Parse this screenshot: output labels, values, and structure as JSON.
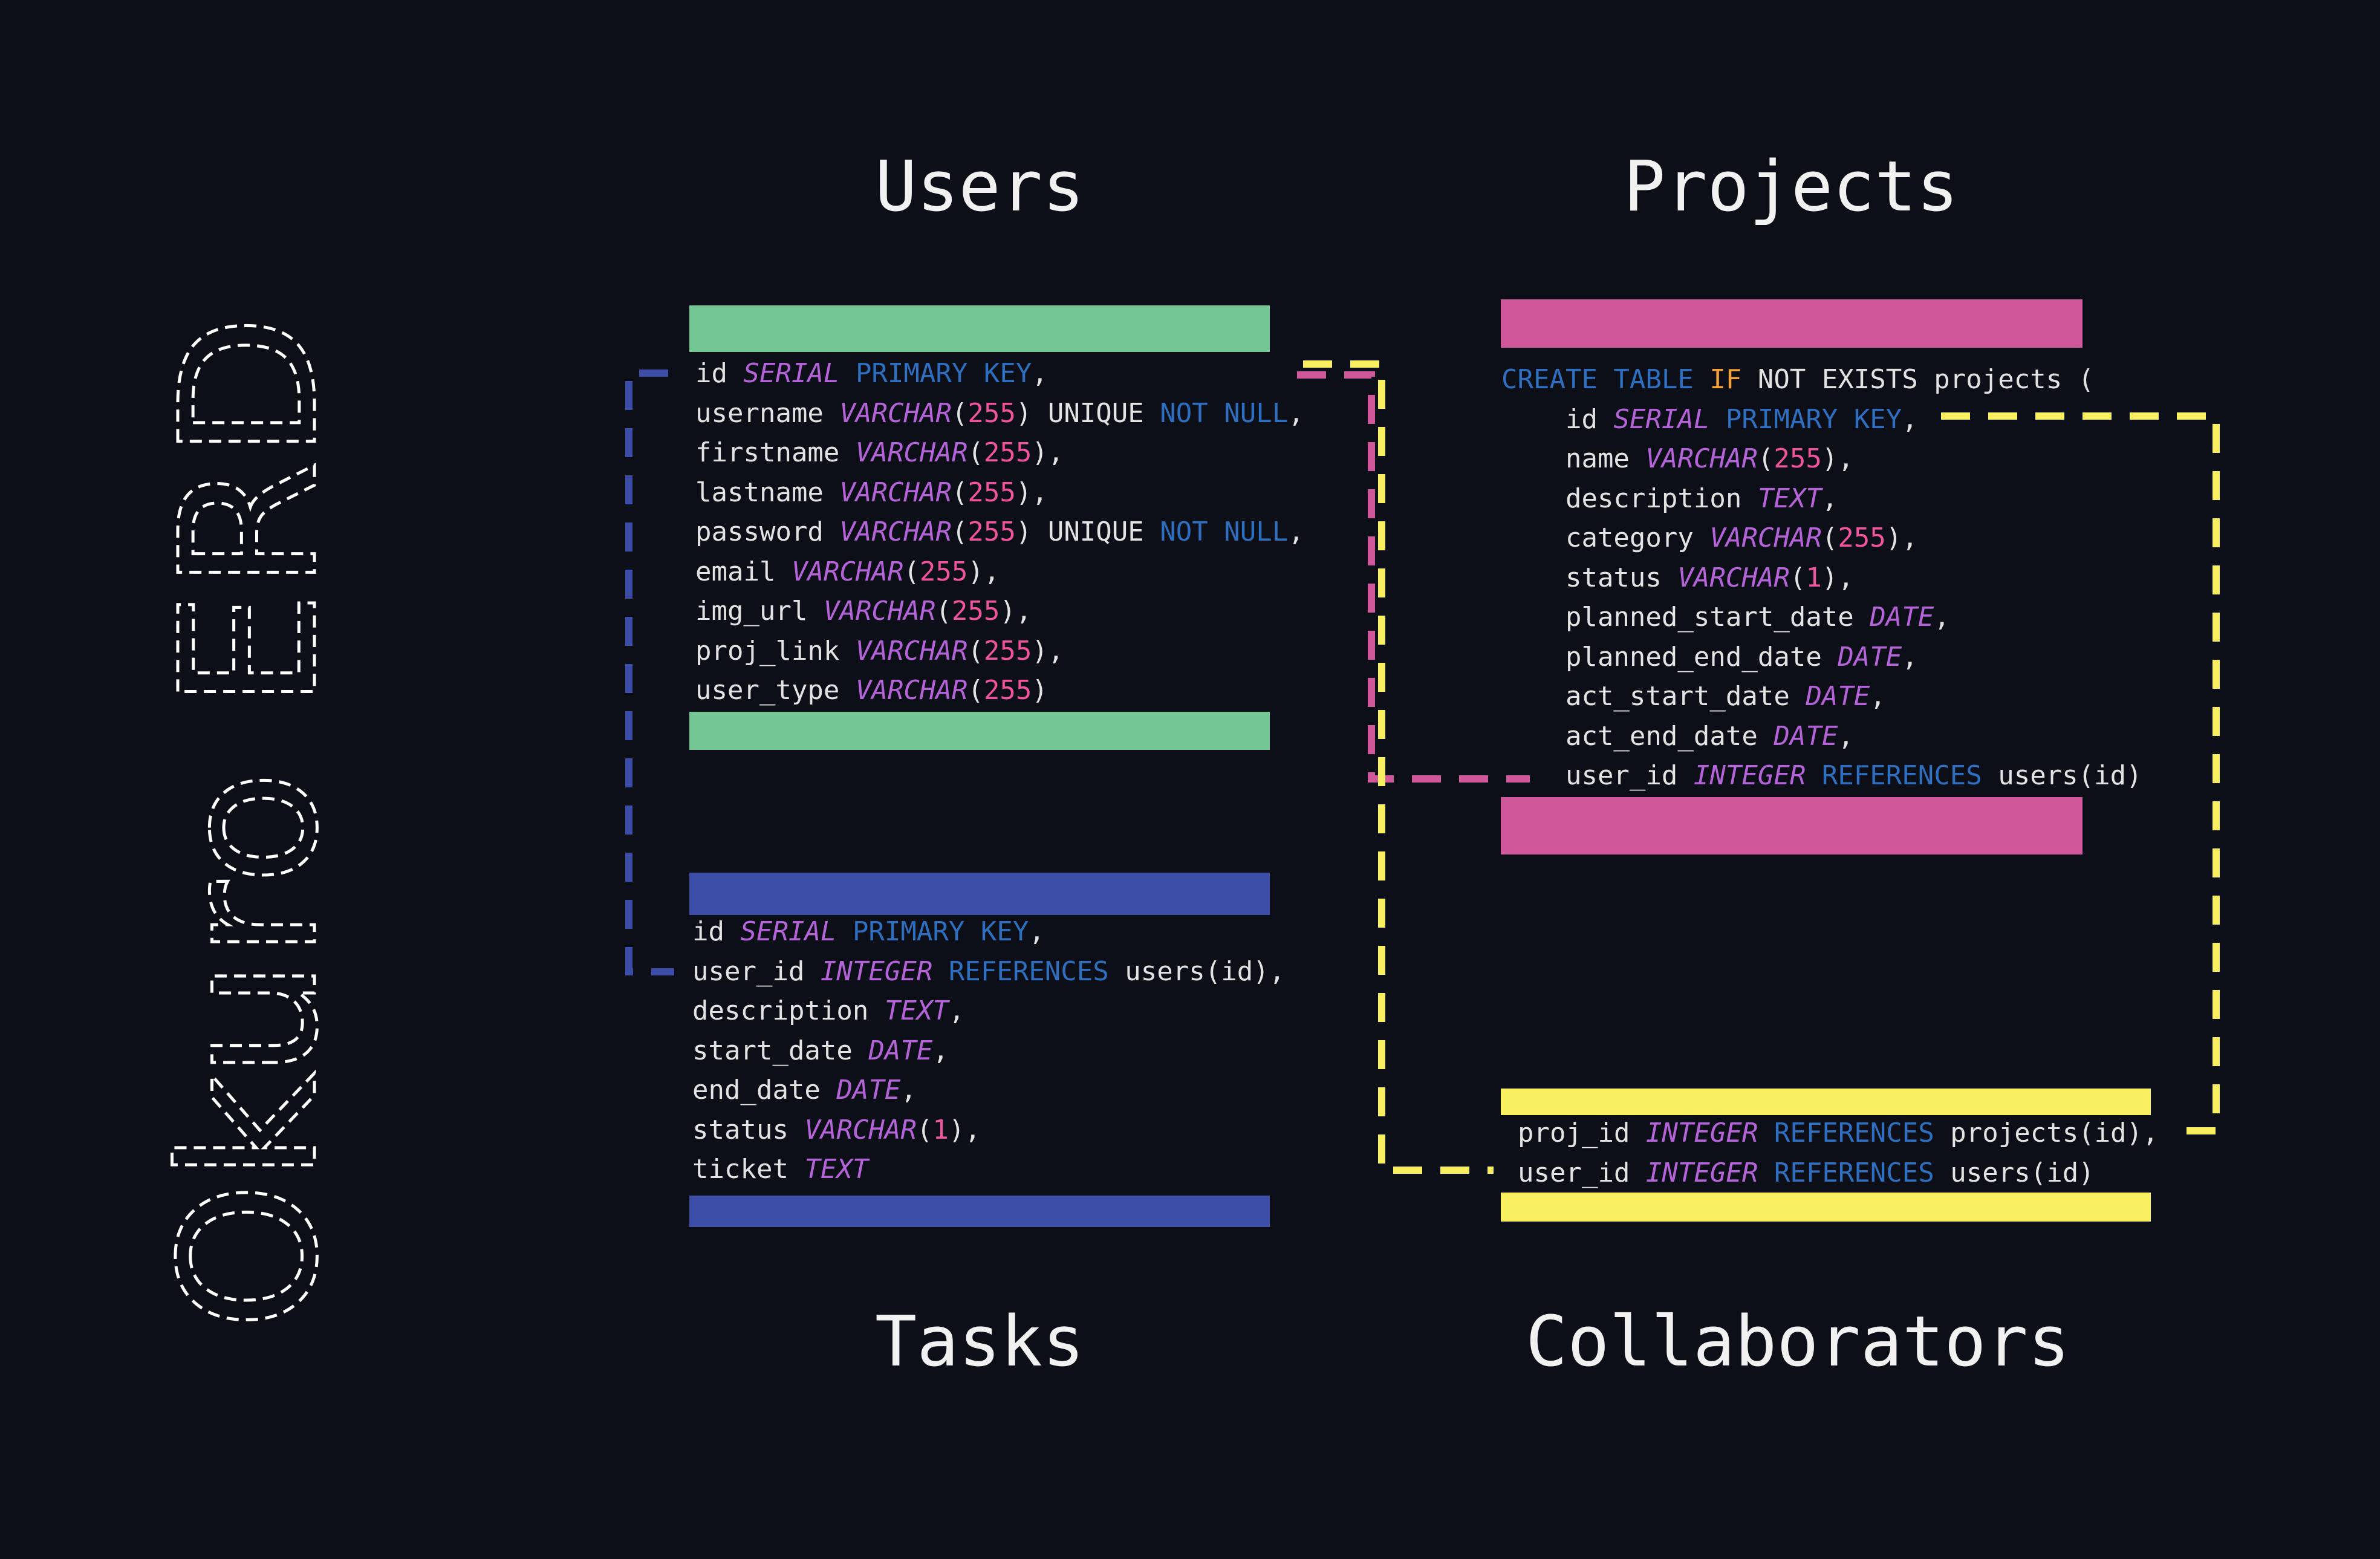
{
  "title": "Okuro ERD",
  "colors": {
    "background": "#0c0f17",
    "users": "#73c795",
    "projects": "#d0579a",
    "tasks": "#3d4ea8",
    "collaborators": "#f7ef60",
    "type": "#b563d8",
    "keyword": "#2f6fc0",
    "number": "#f0549d",
    "if_keyword": "#f2a33c",
    "text": "#e3e3e3"
  },
  "tables": {
    "users": {
      "heading": "Users",
      "lines": [
        [
          {
            "t": "id "
          },
          {
            "t": "SERIAL",
            "c": "type"
          },
          {
            "t": " "
          },
          {
            "t": "PRIMARY KEY",
            "c": "kw"
          },
          {
            "t": ","
          }
        ],
        [
          {
            "t": "username "
          },
          {
            "t": "VARCHAR",
            "c": "type"
          },
          {
            "t": "("
          },
          {
            "t": "255",
            "c": "num"
          },
          {
            "t": ") UNIQUE "
          },
          {
            "t": "NOT NULL",
            "c": "kw"
          },
          {
            "t": ","
          }
        ],
        [
          {
            "t": "firstname "
          },
          {
            "t": "VARCHAR",
            "c": "type"
          },
          {
            "t": "("
          },
          {
            "t": "255",
            "c": "num"
          },
          {
            "t": "),"
          }
        ],
        [
          {
            "t": "lastname "
          },
          {
            "t": "VARCHAR",
            "c": "type"
          },
          {
            "t": "("
          },
          {
            "t": "255",
            "c": "num"
          },
          {
            "t": "),"
          }
        ],
        [
          {
            "t": "password "
          },
          {
            "t": "VARCHAR",
            "c": "type"
          },
          {
            "t": "("
          },
          {
            "t": "255",
            "c": "num"
          },
          {
            "t": ") UNIQUE "
          },
          {
            "t": "NOT NULL",
            "c": "kw"
          },
          {
            "t": ","
          }
        ],
        [
          {
            "t": "email "
          },
          {
            "t": "VARCHAR",
            "c": "type"
          },
          {
            "t": "("
          },
          {
            "t": "255",
            "c": "num"
          },
          {
            "t": "),"
          }
        ],
        [
          {
            "t": "img_url "
          },
          {
            "t": "VARCHAR",
            "c": "type"
          },
          {
            "t": "("
          },
          {
            "t": "255",
            "c": "num"
          },
          {
            "t": "),"
          }
        ],
        [
          {
            "t": "proj_link "
          },
          {
            "t": "VARCHAR",
            "c": "type"
          },
          {
            "t": "("
          },
          {
            "t": "255",
            "c": "num"
          },
          {
            "t": "),"
          }
        ],
        [
          {
            "t": "user_type "
          },
          {
            "t": "VARCHAR",
            "c": "type"
          },
          {
            "t": "("
          },
          {
            "t": "255",
            "c": "num"
          },
          {
            "t": ")"
          }
        ]
      ]
    },
    "projects": {
      "heading": "Projects",
      "lines": [
        [
          {
            "t": "CREATE TABLE",
            "c": "kw"
          },
          {
            "t": " "
          },
          {
            "t": "IF",
            "c": "if"
          },
          {
            "t": " NOT EXISTS projects ("
          }
        ],
        [
          {
            "t": "    id "
          },
          {
            "t": "SERIAL",
            "c": "type"
          },
          {
            "t": " "
          },
          {
            "t": "PRIMARY KEY",
            "c": "kw"
          },
          {
            "t": ","
          }
        ],
        [
          {
            "t": "    name "
          },
          {
            "t": "VARCHAR",
            "c": "type"
          },
          {
            "t": "("
          },
          {
            "t": "255",
            "c": "num"
          },
          {
            "t": "),"
          }
        ],
        [
          {
            "t": "    description "
          },
          {
            "t": "TEXT",
            "c": "type"
          },
          {
            "t": ","
          }
        ],
        [
          {
            "t": "    category "
          },
          {
            "t": "VARCHAR",
            "c": "type"
          },
          {
            "t": "("
          },
          {
            "t": "255",
            "c": "num"
          },
          {
            "t": "),"
          }
        ],
        [
          {
            "t": "    status "
          },
          {
            "t": "VARCHAR",
            "c": "type"
          },
          {
            "t": "("
          },
          {
            "t": "1",
            "c": "num"
          },
          {
            "t": "),"
          }
        ],
        [
          {
            "t": "    planned_start_date "
          },
          {
            "t": "DATE",
            "c": "type"
          },
          {
            "t": ","
          }
        ],
        [
          {
            "t": "    planned_end_date "
          },
          {
            "t": "DATE",
            "c": "type"
          },
          {
            "t": ","
          }
        ],
        [
          {
            "t": "    act_start_date "
          },
          {
            "t": "DATE",
            "c": "type"
          },
          {
            "t": ","
          }
        ],
        [
          {
            "t": "    act_end_date "
          },
          {
            "t": "DATE",
            "c": "type"
          },
          {
            "t": ","
          }
        ],
        [
          {
            "t": "    user_id "
          },
          {
            "t": "INTEGER",
            "c": "type"
          },
          {
            "t": " "
          },
          {
            "t": "REFERENCES",
            "c": "kw"
          },
          {
            "t": " users(id)"
          }
        ]
      ]
    },
    "tasks": {
      "heading": "Tasks",
      "lines": [
        [
          {
            "t": "id "
          },
          {
            "t": "SERIAL",
            "c": "type"
          },
          {
            "t": " "
          },
          {
            "t": "PRIMARY KEY",
            "c": "kw"
          },
          {
            "t": ","
          }
        ],
        [
          {
            "t": "user_id "
          },
          {
            "t": "INTEGER",
            "c": "type"
          },
          {
            "t": " "
          },
          {
            "t": "REFERENCES",
            "c": "kw"
          },
          {
            "t": " users(id),"
          }
        ],
        [
          {
            "t": "description "
          },
          {
            "t": "TEXT",
            "c": "type"
          },
          {
            "t": ","
          }
        ],
        [
          {
            "t": "start_date "
          },
          {
            "t": "DATE",
            "c": "type"
          },
          {
            "t": ","
          }
        ],
        [
          {
            "t": "end_date "
          },
          {
            "t": "DATE",
            "c": "type"
          },
          {
            "t": ","
          }
        ],
        [
          {
            "t": "status "
          },
          {
            "t": "VARCHAR",
            "c": "type"
          },
          {
            "t": "("
          },
          {
            "t": "1",
            "c": "num"
          },
          {
            "t": "),"
          }
        ],
        [
          {
            "t": "ticket "
          },
          {
            "t": "TEXT",
            "c": "type"
          }
        ]
      ]
    },
    "collaborators": {
      "heading": "Collaborators",
      "lines": [
        [
          {
            "t": "proj_id "
          },
          {
            "t": "INTEGER",
            "c": "type"
          },
          {
            "t": " "
          },
          {
            "t": "REFERENCES",
            "c": "kw"
          },
          {
            "t": " projects(id),"
          }
        ],
        [
          {
            "t": "user_id "
          },
          {
            "t": "INTEGER",
            "c": "type"
          },
          {
            "t": " "
          },
          {
            "t": "REFERENCES",
            "c": "kw"
          },
          {
            "t": " users(id)"
          }
        ]
      ]
    }
  }
}
